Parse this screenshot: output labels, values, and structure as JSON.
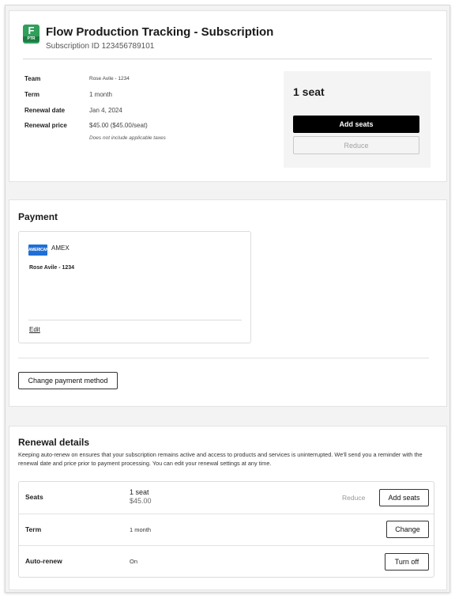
{
  "subscription": {
    "product_icon": {
      "letter": "F",
      "code": "PTR",
      "color": "#2f9f5a"
    },
    "title": "Flow Production Tracking - Subscription",
    "id_text": "Subscription ID 123456789101",
    "details": {
      "team_label": "Team",
      "team_value": "Rose Avile - 1234",
      "term_label": "Term",
      "term_value": "1 month",
      "renewal_date_label": "Renewal date",
      "renewal_date_value": "Jan 4, 2024",
      "renewal_price_label": "Renewal price",
      "renewal_price_value": "$45.00 ($45.00/seat)",
      "tax_note": "Does not include applicable taxes"
    },
    "seats": {
      "count_label": "1 seat",
      "add_button": "Add seats",
      "reduce_button": "Reduce"
    }
  },
  "payment": {
    "title": "Payment",
    "card_brand_logo": "AMERICAN EXPRESS",
    "card_brand": "AMEX",
    "card_holder": "Rose Avile - 1234",
    "edit_link": "Edit",
    "change_button": "Change payment method"
  },
  "renewal": {
    "title": "Renewal details",
    "description": "Keeping auto-renew on ensures that your subscription remains active and access to products and services is uninterrupted. We'll send you a reminder with the renewal date and price prior to payment processing. You can edit your renewal settings at any time.",
    "rows": [
      {
        "label": "Seats",
        "value": "1 seat",
        "sub_value": "$45.00",
        "secondary_action": "Reduce",
        "action": "Add seats"
      },
      {
        "label": "Term",
        "value": "1 month",
        "action": "Change"
      },
      {
        "label": "Auto-renew",
        "value": "On",
        "action": "Turn off"
      }
    ]
  },
  "colors": {
    "accent_black": "#000000",
    "amex_blue": "#1f6fd6",
    "panel_gray": "#f4f4f4"
  }
}
